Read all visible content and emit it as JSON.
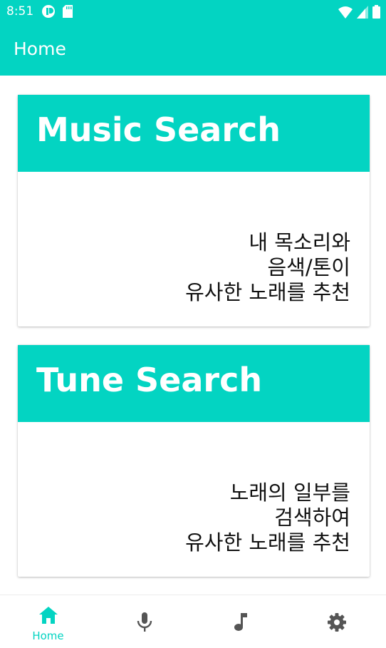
{
  "status_bar": {
    "time": "8:51"
  },
  "app_bar": {
    "title": "Home"
  },
  "cards": [
    {
      "title": "Music Search",
      "description": "내 목소리와\n음색/톤이\n유사한 노래를 추천"
    },
    {
      "title": "Tune Search",
      "description": "노래의 일부를\n검색하여\n유사한 노래를 추천"
    }
  ],
  "bottom_nav": {
    "items": [
      {
        "label": "Home",
        "icon": "home-icon",
        "active": true
      },
      {
        "label": "",
        "icon": "mic-icon",
        "active": false
      },
      {
        "label": "",
        "icon": "music-note-icon",
        "active": false
      },
      {
        "label": "",
        "icon": "settings-icon",
        "active": false
      }
    ]
  },
  "colors": {
    "accent": "#03d4c2",
    "inactive_icon": "#555555",
    "text": "#111111"
  }
}
